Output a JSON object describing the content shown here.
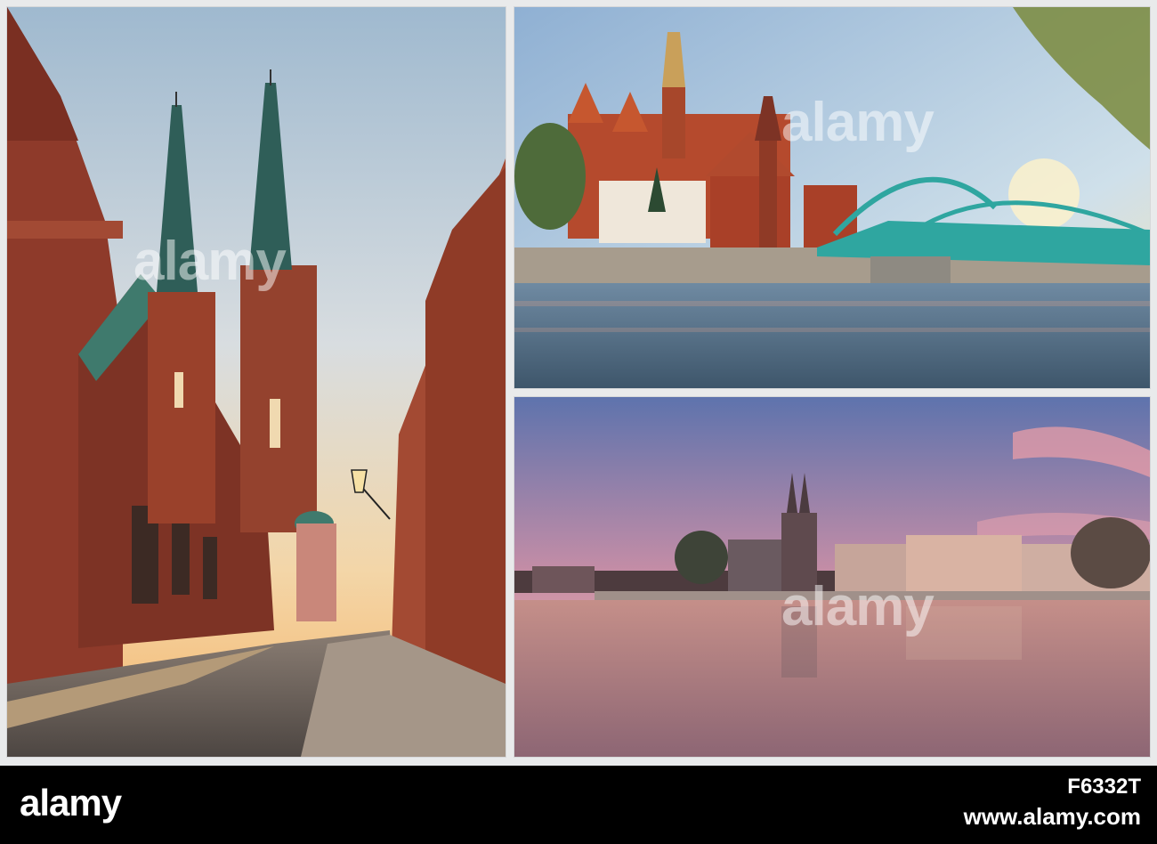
{
  "watermark": {
    "text": "alamy"
  },
  "footer": {
    "brand": "alamy",
    "image_id": "F6332T",
    "url": "www.alamy.com"
  },
  "colors": {
    "brick": "#9c3f28",
    "sky_left": "#cfe0ea",
    "bridge": "#2fa6a0",
    "sunset": "#d9a0ad"
  }
}
